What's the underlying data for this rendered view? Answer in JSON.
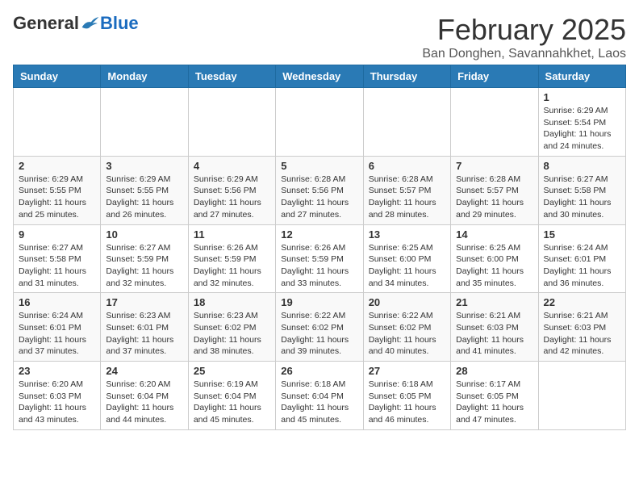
{
  "header": {
    "logo_general": "General",
    "logo_blue": "Blue",
    "month_title": "February 2025",
    "location": "Ban Donghen, Savannahkhet, Laos"
  },
  "weekdays": [
    "Sunday",
    "Monday",
    "Tuesday",
    "Wednesday",
    "Thursday",
    "Friday",
    "Saturday"
  ],
  "weeks": [
    [
      {
        "day": "",
        "info": ""
      },
      {
        "day": "",
        "info": ""
      },
      {
        "day": "",
        "info": ""
      },
      {
        "day": "",
        "info": ""
      },
      {
        "day": "",
        "info": ""
      },
      {
        "day": "",
        "info": ""
      },
      {
        "day": "1",
        "info": "Sunrise: 6:29 AM\nSunset: 5:54 PM\nDaylight: 11 hours\nand 24 minutes."
      }
    ],
    [
      {
        "day": "2",
        "info": "Sunrise: 6:29 AM\nSunset: 5:55 PM\nDaylight: 11 hours\nand 25 minutes."
      },
      {
        "day": "3",
        "info": "Sunrise: 6:29 AM\nSunset: 5:55 PM\nDaylight: 11 hours\nand 26 minutes."
      },
      {
        "day": "4",
        "info": "Sunrise: 6:29 AM\nSunset: 5:56 PM\nDaylight: 11 hours\nand 27 minutes."
      },
      {
        "day": "5",
        "info": "Sunrise: 6:28 AM\nSunset: 5:56 PM\nDaylight: 11 hours\nand 27 minutes."
      },
      {
        "day": "6",
        "info": "Sunrise: 6:28 AM\nSunset: 5:57 PM\nDaylight: 11 hours\nand 28 minutes."
      },
      {
        "day": "7",
        "info": "Sunrise: 6:28 AM\nSunset: 5:57 PM\nDaylight: 11 hours\nand 29 minutes."
      },
      {
        "day": "8",
        "info": "Sunrise: 6:27 AM\nSunset: 5:58 PM\nDaylight: 11 hours\nand 30 minutes."
      }
    ],
    [
      {
        "day": "9",
        "info": "Sunrise: 6:27 AM\nSunset: 5:58 PM\nDaylight: 11 hours\nand 31 minutes."
      },
      {
        "day": "10",
        "info": "Sunrise: 6:27 AM\nSunset: 5:59 PM\nDaylight: 11 hours\nand 32 minutes."
      },
      {
        "day": "11",
        "info": "Sunrise: 6:26 AM\nSunset: 5:59 PM\nDaylight: 11 hours\nand 32 minutes."
      },
      {
        "day": "12",
        "info": "Sunrise: 6:26 AM\nSunset: 5:59 PM\nDaylight: 11 hours\nand 33 minutes."
      },
      {
        "day": "13",
        "info": "Sunrise: 6:25 AM\nSunset: 6:00 PM\nDaylight: 11 hours\nand 34 minutes."
      },
      {
        "day": "14",
        "info": "Sunrise: 6:25 AM\nSunset: 6:00 PM\nDaylight: 11 hours\nand 35 minutes."
      },
      {
        "day": "15",
        "info": "Sunrise: 6:24 AM\nSunset: 6:01 PM\nDaylight: 11 hours\nand 36 minutes."
      }
    ],
    [
      {
        "day": "16",
        "info": "Sunrise: 6:24 AM\nSunset: 6:01 PM\nDaylight: 11 hours\nand 37 minutes."
      },
      {
        "day": "17",
        "info": "Sunrise: 6:23 AM\nSunset: 6:01 PM\nDaylight: 11 hours\nand 37 minutes."
      },
      {
        "day": "18",
        "info": "Sunrise: 6:23 AM\nSunset: 6:02 PM\nDaylight: 11 hours\nand 38 minutes."
      },
      {
        "day": "19",
        "info": "Sunrise: 6:22 AM\nSunset: 6:02 PM\nDaylight: 11 hours\nand 39 minutes."
      },
      {
        "day": "20",
        "info": "Sunrise: 6:22 AM\nSunset: 6:02 PM\nDaylight: 11 hours\nand 40 minutes."
      },
      {
        "day": "21",
        "info": "Sunrise: 6:21 AM\nSunset: 6:03 PM\nDaylight: 11 hours\nand 41 minutes."
      },
      {
        "day": "22",
        "info": "Sunrise: 6:21 AM\nSunset: 6:03 PM\nDaylight: 11 hours\nand 42 minutes."
      }
    ],
    [
      {
        "day": "23",
        "info": "Sunrise: 6:20 AM\nSunset: 6:03 PM\nDaylight: 11 hours\nand 43 minutes."
      },
      {
        "day": "24",
        "info": "Sunrise: 6:20 AM\nSunset: 6:04 PM\nDaylight: 11 hours\nand 44 minutes."
      },
      {
        "day": "25",
        "info": "Sunrise: 6:19 AM\nSunset: 6:04 PM\nDaylight: 11 hours\nand 45 minutes."
      },
      {
        "day": "26",
        "info": "Sunrise: 6:18 AM\nSunset: 6:04 PM\nDaylight: 11 hours\nand 45 minutes."
      },
      {
        "day": "27",
        "info": "Sunrise: 6:18 AM\nSunset: 6:05 PM\nDaylight: 11 hours\nand 46 minutes."
      },
      {
        "day": "28",
        "info": "Sunrise: 6:17 AM\nSunset: 6:05 PM\nDaylight: 11 hours\nand 47 minutes."
      },
      {
        "day": "",
        "info": ""
      }
    ]
  ]
}
